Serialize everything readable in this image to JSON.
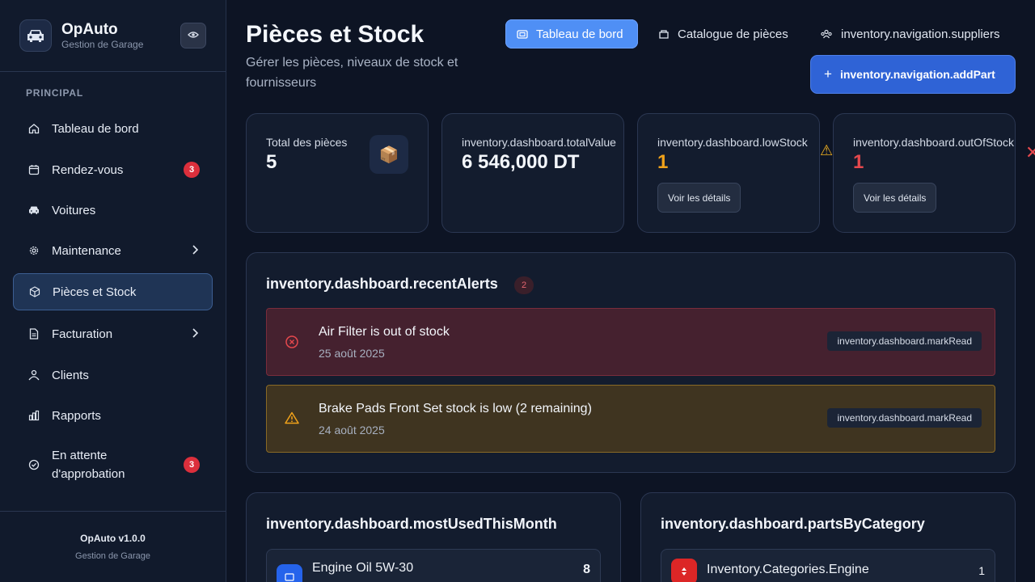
{
  "app": {
    "name": "OpAuto",
    "subtitle": "Gestion de Garage",
    "version": "OpAuto v1.0.0",
    "version_sub": "Gestion de Garage"
  },
  "sidebar": {
    "section": "PRINCIPAL",
    "items": [
      {
        "label": "Tableau de bord",
        "icon": "home-icon"
      },
      {
        "label": "Rendez-vous",
        "icon": "calendar-icon",
        "badge": "3"
      },
      {
        "label": "Voitures",
        "icon": "car-icon"
      },
      {
        "label": "Maintenance",
        "icon": "gear-icon"
      },
      {
        "label": "Pièces et Stock",
        "icon": "box-icon",
        "active": true
      },
      {
        "label": "Facturation",
        "icon": "document-icon"
      },
      {
        "label": "Clients",
        "icon": "clients-icon"
      },
      {
        "label": "Rapports",
        "icon": "chart-icon"
      },
      {
        "label": "En attente",
        "label2": "d'approbation",
        "icon": "check-circle-icon",
        "badge": "3"
      }
    ]
  },
  "header": {
    "title": "Pièces et Stock",
    "subtitle": "Gérer les pièces, niveaux de stock et fournisseurs",
    "tabs": [
      {
        "label": "Tableau de bord",
        "active": true
      },
      {
        "label": "Catalogue de pièces"
      },
      {
        "label": "inventory.navigation.suppliers"
      }
    ],
    "add_button": "inventory.navigation.addPart"
  },
  "stats": [
    {
      "label": "Total des pièces",
      "value": "5",
      "icon": "package-icon"
    },
    {
      "label": "inventory.dashboard.totalValue",
      "value": "6 546,000 DT"
    },
    {
      "label": "inventory.dashboard.lowStock",
      "value": "1",
      "value_color": "#f0a21a",
      "details": "Voir les détails"
    },
    {
      "label": "inventory.dashboard.outOfStock",
      "value": "1",
      "value_color": "#e5484d",
      "details": "Voir les détails"
    }
  ],
  "alerts": {
    "title": "inventory.dashboard.recentAlerts",
    "count": "2",
    "items": [
      {
        "type": "error",
        "title": "Air Filter is out of stock",
        "date": "25 août 2025",
        "action": "inventory.dashboard.markRead"
      },
      {
        "type": "warning",
        "title": "Brake Pads Front Set stock is low (2 remaining)",
        "date": "24 août 2025",
        "action": "inventory.dashboard.markRead"
      }
    ]
  },
  "most_used": {
    "title": "inventory.dashboard.mostUsedThisMonth",
    "items": [
      {
        "name": "Engine Oil 5W-30",
        "count": "8"
      }
    ]
  },
  "by_category": {
    "title": "inventory.dashboard.partsByCategory",
    "items": [
      {
        "name": "Inventory.Categories.Engine",
        "count": "1"
      }
    ]
  },
  "colors": {
    "accent": "#4f8ff5",
    "primary_button": "#2f63d6",
    "badge": "#dc2f3c",
    "warning": "#f0a21a",
    "danger": "#e5484d"
  }
}
